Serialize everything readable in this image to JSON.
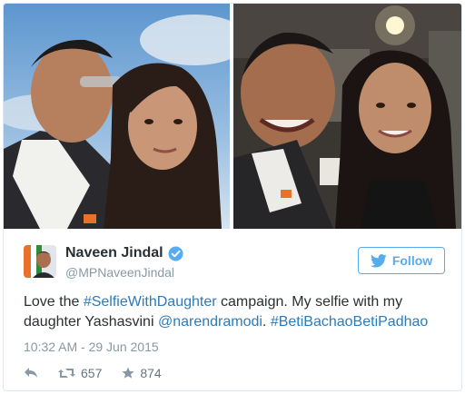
{
  "tweet": {
    "author": {
      "display_name": "Naveen Jindal",
      "screen_name": "@MPNaveenJindal",
      "verified_icon": "verified-badge-icon",
      "avatar_icon": "profile-avatar"
    },
    "follow_label": "Follow",
    "text": {
      "part1": "Love the ",
      "hashtag1": "#SelfieWithDaughter",
      "part2": " campaign. My selfie with my daughter Yashasvini ",
      "mention": "@narendramodi",
      "part3": ". ",
      "hashtag2": "#BetiBachaoBetiPadhao"
    },
    "timestamp": "10:32 AM - 29 Jun 2015",
    "actions": {
      "reply_icon": "reply-icon",
      "retweet_icon": "retweet-icon",
      "retweet_count": "657",
      "favorite_icon": "star-icon",
      "favorite_count": "874"
    },
    "colors": {
      "accent": "#55acee",
      "link": "#2b7bb9",
      "muted": "#8899a6",
      "text": "#292f33"
    }
  }
}
